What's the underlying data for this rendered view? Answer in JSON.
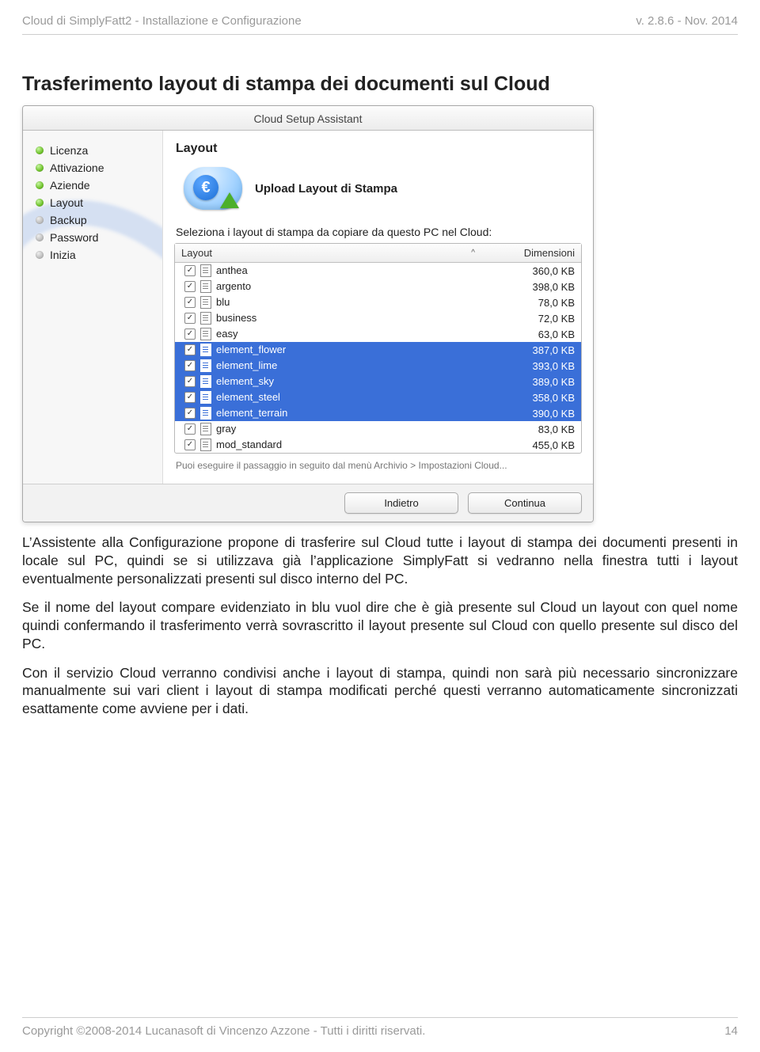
{
  "header": {
    "left": "Cloud di SimplyFatt2 - Installazione e Configurazione",
    "right": "v. 2.8.6 - Nov. 2014"
  },
  "section_heading": "Trasferimento layout di stampa dei documenti sul Cloud",
  "wizard": {
    "title": "Cloud Setup Assistant",
    "steps": [
      {
        "dot": "green",
        "label": "Licenza"
      },
      {
        "dot": "green",
        "label": "Attivazione"
      },
      {
        "dot": "green",
        "label": "Aziende"
      },
      {
        "dot": "green",
        "label": "Layout"
      },
      {
        "dot": "grey",
        "label": "Backup"
      },
      {
        "dot": "grey",
        "label": "Password"
      },
      {
        "dot": "grey",
        "label": "Inizia"
      }
    ],
    "panel_heading": "Layout",
    "euro_symbol": "€",
    "upload_title": "Upload Layout di Stampa",
    "instruction": "Seleziona i layout di stampa da copiare da questo PC nel Cloud:",
    "columns": {
      "c1": "Layout",
      "sort": "^",
      "c2": "Dimensioni"
    },
    "rows": [
      {
        "name": "anthea",
        "size": "360,0 KB",
        "checked": true,
        "selected": false
      },
      {
        "name": "argento",
        "size": "398,0 KB",
        "checked": true,
        "selected": false
      },
      {
        "name": "blu",
        "size": "78,0 KB",
        "checked": true,
        "selected": false
      },
      {
        "name": "business",
        "size": "72,0 KB",
        "checked": true,
        "selected": false
      },
      {
        "name": "easy",
        "size": "63,0 KB",
        "checked": true,
        "selected": false
      },
      {
        "name": "element_flower",
        "size": "387,0 KB",
        "checked": true,
        "selected": true
      },
      {
        "name": "element_lime",
        "size": "393,0 KB",
        "checked": true,
        "selected": true
      },
      {
        "name": "element_sky",
        "size": "389,0 KB",
        "checked": true,
        "selected": true
      },
      {
        "name": "element_steel",
        "size": "358,0 KB",
        "checked": true,
        "selected": true
      },
      {
        "name": "element_terrain",
        "size": "390,0 KB",
        "checked": true,
        "selected": true
      },
      {
        "name": "gray",
        "size": "83,0 KB",
        "checked": true,
        "selected": false
      },
      {
        "name": "mod_standard",
        "size": "455,0 KB",
        "checked": true,
        "selected": false
      }
    ],
    "hint": "Puoi eseguire il passaggio in seguito dal menù Archivio > Impostazioni Cloud...",
    "buttons": {
      "back": "Indietro",
      "next": "Continua"
    }
  },
  "paragraphs": [
    "L’Assistente alla Configurazione propone di trasferire sul Cloud tutte i layout di stampa dei documenti presenti in locale sul PC, quindi se si utilizzava già l’applicazione SimplyFatt si vedranno nella finestra tutti i layout eventualmente personalizzati presenti sul disco interno del PC.",
    "Se il nome del layout compare evidenziato in blu vuol dire che è già presente sul Cloud un layout con quel nome quindi confermando il trasferimento verrà sovrascritto il layout presente sul Cloud con quello presente sul disco del PC.",
    "Con il servizio Cloud verranno condivisi anche i layout di stampa, quindi non sarà più necessario sincronizzare manualmente sui vari client i layout di stampa modificati perché questi verranno automaticamente sincronizzati esattamente come avviene per i dati."
  ],
  "footer": {
    "left": "Copyright ©2008-2014 Lucanasoft di Vincenzo Azzone - Tutti i diritti riservati.",
    "right": "14"
  },
  "check_glyph": "✓"
}
